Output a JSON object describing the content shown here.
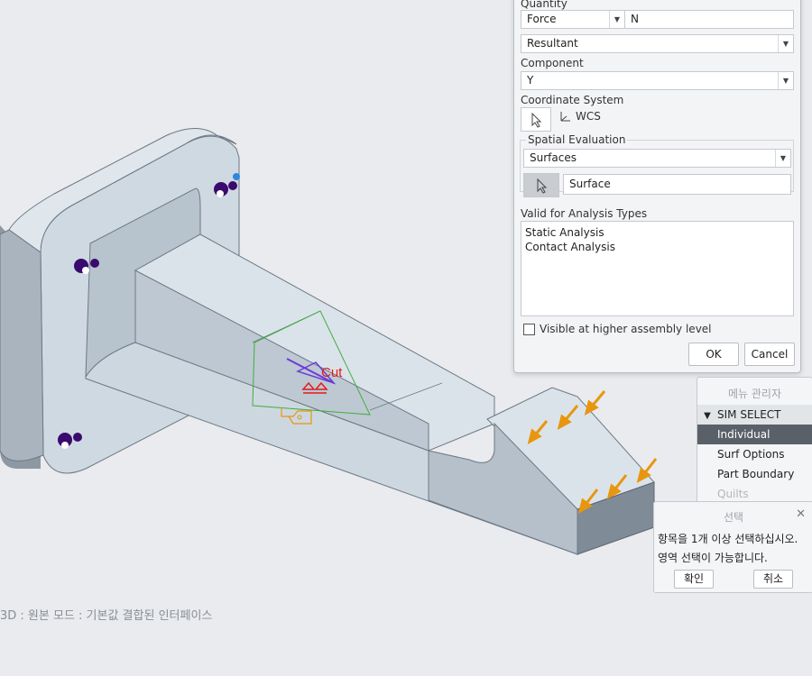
{
  "dialog": {
    "quantity_label": "Quantity",
    "quantity_value": "Force",
    "unit_value": "N",
    "resultant_value": "Resultant",
    "component_label": "Component",
    "component_value": "Y",
    "coord_label": "Coordinate System",
    "coord_value": "WCS",
    "spatial_label": "Spatial Evaluation",
    "spatial_value": "Surfaces",
    "surface_value": "Surface",
    "valid_label": "Valid for Analysis Types",
    "analysis_types": [
      "Static Analysis",
      "Contact Analysis"
    ],
    "visible_label": "Visible at higher assembly level",
    "ok_label": "OK",
    "cancel_label": "Cancel"
  },
  "menu": {
    "title": "메뉴 관리자",
    "header": "SIM SELECT",
    "items": [
      "Individual",
      "Surf Options",
      "Part Boundary",
      "Quilts"
    ]
  },
  "select": {
    "title": "선택",
    "line1": "항목을 1개 이상 선택하십시오.",
    "line2": "영역 선택이 가능합니다.",
    "confirm_label": "확인",
    "cancel_label": "취소"
  },
  "viewport": {
    "cut_label": "Cut",
    "status": "3D : 원본 모드 : 기본값 결합된 인터페이스"
  },
  "colors": {
    "load_arrow": "#e8960e",
    "constraint": "#3b0a6e",
    "cut_red": "#e21b1b",
    "part_face": "#c9d4dd",
    "selected_menu": "#5a6068"
  }
}
